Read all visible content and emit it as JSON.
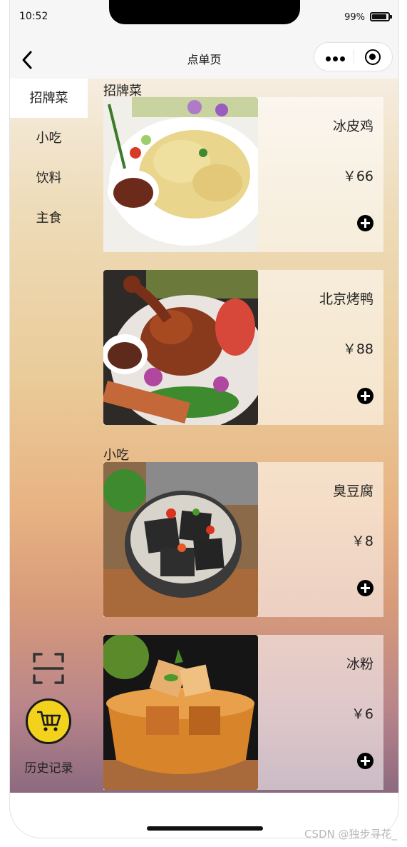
{
  "status_bar": {
    "time": "10:52",
    "battery": "99%"
  },
  "nav": {
    "title": "点单页",
    "back_icon": "chevron-left-icon",
    "more_icon": "more-dots-icon",
    "close_icon": "target-close-icon"
  },
  "sidebar": {
    "categories": [
      {
        "label": "招牌菜",
        "active": true
      },
      {
        "label": "小吃",
        "active": false
      },
      {
        "label": "饮料",
        "active": false
      },
      {
        "label": "主食",
        "active": false
      }
    ],
    "scan_icon": "scan-icon",
    "cart_icon": "cart-icon",
    "history_label": "历史记录"
  },
  "sections": [
    {
      "title": "招牌菜",
      "dishes": [
        {
          "name": "冰皮鸡",
          "price": "￥66",
          "photo": "chicken-dish-photo"
        },
        {
          "name": "北京烤鸭",
          "price": "￥88",
          "photo": "roast-duck-photo"
        }
      ]
    },
    {
      "title": "小吃",
      "dishes": [
        {
          "name": "臭豆腐",
          "price": "￥8",
          "photo": "stinky-tofu-photo"
        },
        {
          "name": "冰粉",
          "price": "￥6",
          "photo": "ice-jelly-photo"
        }
      ]
    }
  ],
  "colors": {
    "cart_button": "#f2d21c",
    "active_tab_bg": "#ffffff"
  },
  "watermark": "CSDN @独步寻花_"
}
